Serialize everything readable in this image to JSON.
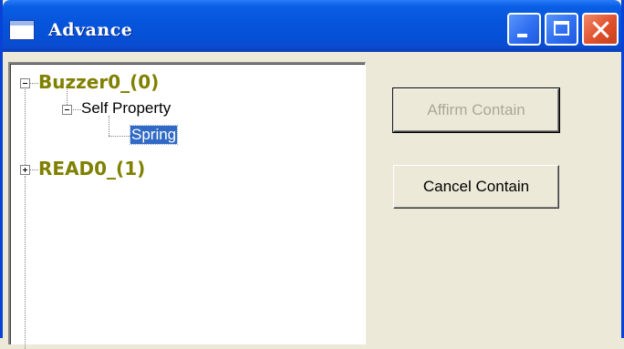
{
  "window": {
    "title": "Advance",
    "icons": {
      "app": "window-icon",
      "minimize": "minimize-icon",
      "maximize": "maximize-icon",
      "close": "close-icon"
    },
    "colors": {
      "titlebar": "#0654dc",
      "close": "#e0502c",
      "face": "#ece9d8"
    }
  },
  "tree": {
    "colors": {
      "root_text": "#808000",
      "selection": "#316ac5"
    },
    "nodes": [
      {
        "label": "Buzzer0_(0)",
        "expanded": true,
        "level": 0
      },
      {
        "label": "Self Property",
        "expanded": true,
        "level": 1
      },
      {
        "label": "Spring",
        "selected": true,
        "level": 2
      },
      {
        "label": "READ0_(1)",
        "expanded": false,
        "level": 0
      }
    ]
  },
  "buttons": {
    "affirm": {
      "label": "Affirm Contain",
      "enabled": false
    },
    "cancel": {
      "label": "Cancel Contain",
      "enabled": true
    }
  }
}
